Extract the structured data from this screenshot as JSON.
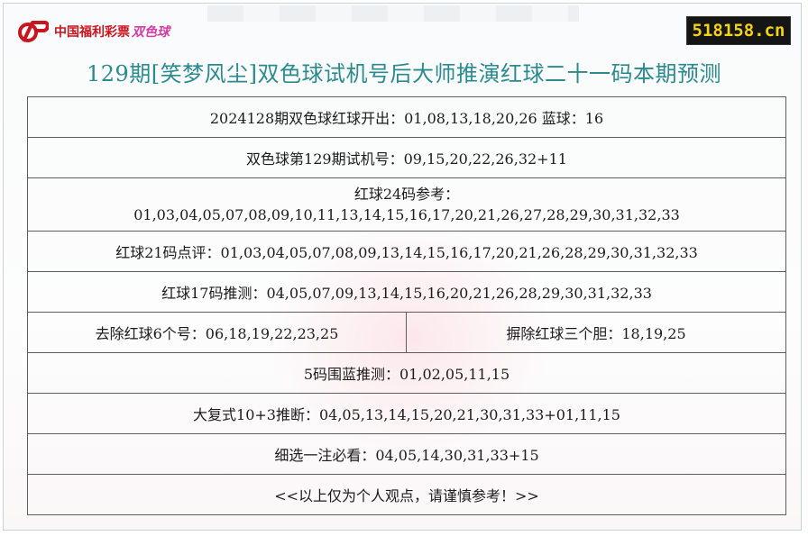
{
  "header": {
    "logo_text": "中国福利彩票",
    "logo_game": "双色球",
    "site_badge": "518158.cn",
    "title": "129期[笑梦风尘]双色球试机号后大师推演红球二十一码本期预测"
  },
  "rows": {
    "draw_result": "2024128期双色球红球开出：01,08,13,18,20,26 蓝球：16",
    "trial_numbers": "双色球第129期试机号：09,15,20,22,26,32+11",
    "red24_label": "红球24码参考：",
    "red24_numbers": "01,03,04,05,07,08,09,10,11,13,14,15,16,17,20,21,26,27,28,29,30,31,32,33",
    "red21": "红球21码点评：01,03,04,05,07,08,09,13,14,15,16,17,20,21,26,28,29,30,31,32,33",
    "red17": "红球17码推测：04,05,07,09,13,14,15,16,20,21,26,28,29,30,31,32,33",
    "remove6": "去除红球6个号：06,18,19,22,23,25",
    "kill3": "摒除红球三个胆：18,19,25",
    "blue5": "5码围蓝推测：01,02,05,11,15",
    "compound": "大复式10+3推断：04,05,13,14,15,20,21,30,31,33+01,11,15",
    "pick": "细选一注必看：04,05,14,30,31,33+15",
    "disclaimer": "<<以上仅为个人观点，请谨慎参考！>>"
  },
  "colors": {
    "title": "#2a8a8e",
    "logo_red": "#c9151e",
    "logo_game": "#d63ba3",
    "badge_bg": "#151515",
    "badge_text": "#f3d21a"
  }
}
